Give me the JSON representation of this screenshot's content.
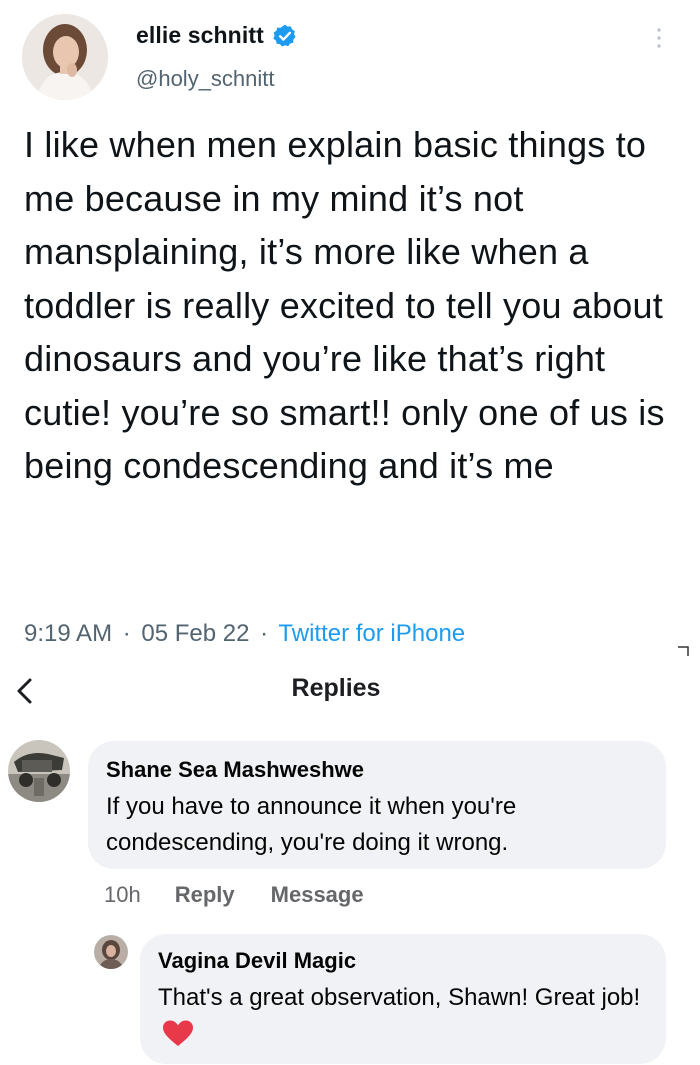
{
  "tweet": {
    "author": {
      "name": "ellie schnitt",
      "handle": "@holy_schnitt",
      "verified": true
    },
    "text": "I like when men explain basic things to me because in my mind it’s not mansplaining, it’s more like when a toddler is really excited to tell you about dinosaurs and you’re like that’s right cutie! you’re so smart!! only one of us is being condescending and it’s me",
    "time": "9:19 AM",
    "date": "05 Feb 22",
    "source": "Twitter for iPhone",
    "separator": "·"
  },
  "replies_header": {
    "title": "Replies"
  },
  "comments": [
    {
      "name": "Shane Sea Mashweshwe",
      "text": "If you have to announce it when you're condescending, you're doing it wrong.",
      "time": "10h",
      "reply_label": "Reply",
      "message_label": "Message"
    },
    {
      "name": "Vagina Devil Magic",
      "text": "That's a great observation, Shawn! Great job!",
      "emoji": "heart-icon"
    }
  ],
  "colors": {
    "verified": "#1d9bf0",
    "link": "#1d9bf0",
    "bubble": "#f0f2f5",
    "heart": "#e8394a"
  }
}
